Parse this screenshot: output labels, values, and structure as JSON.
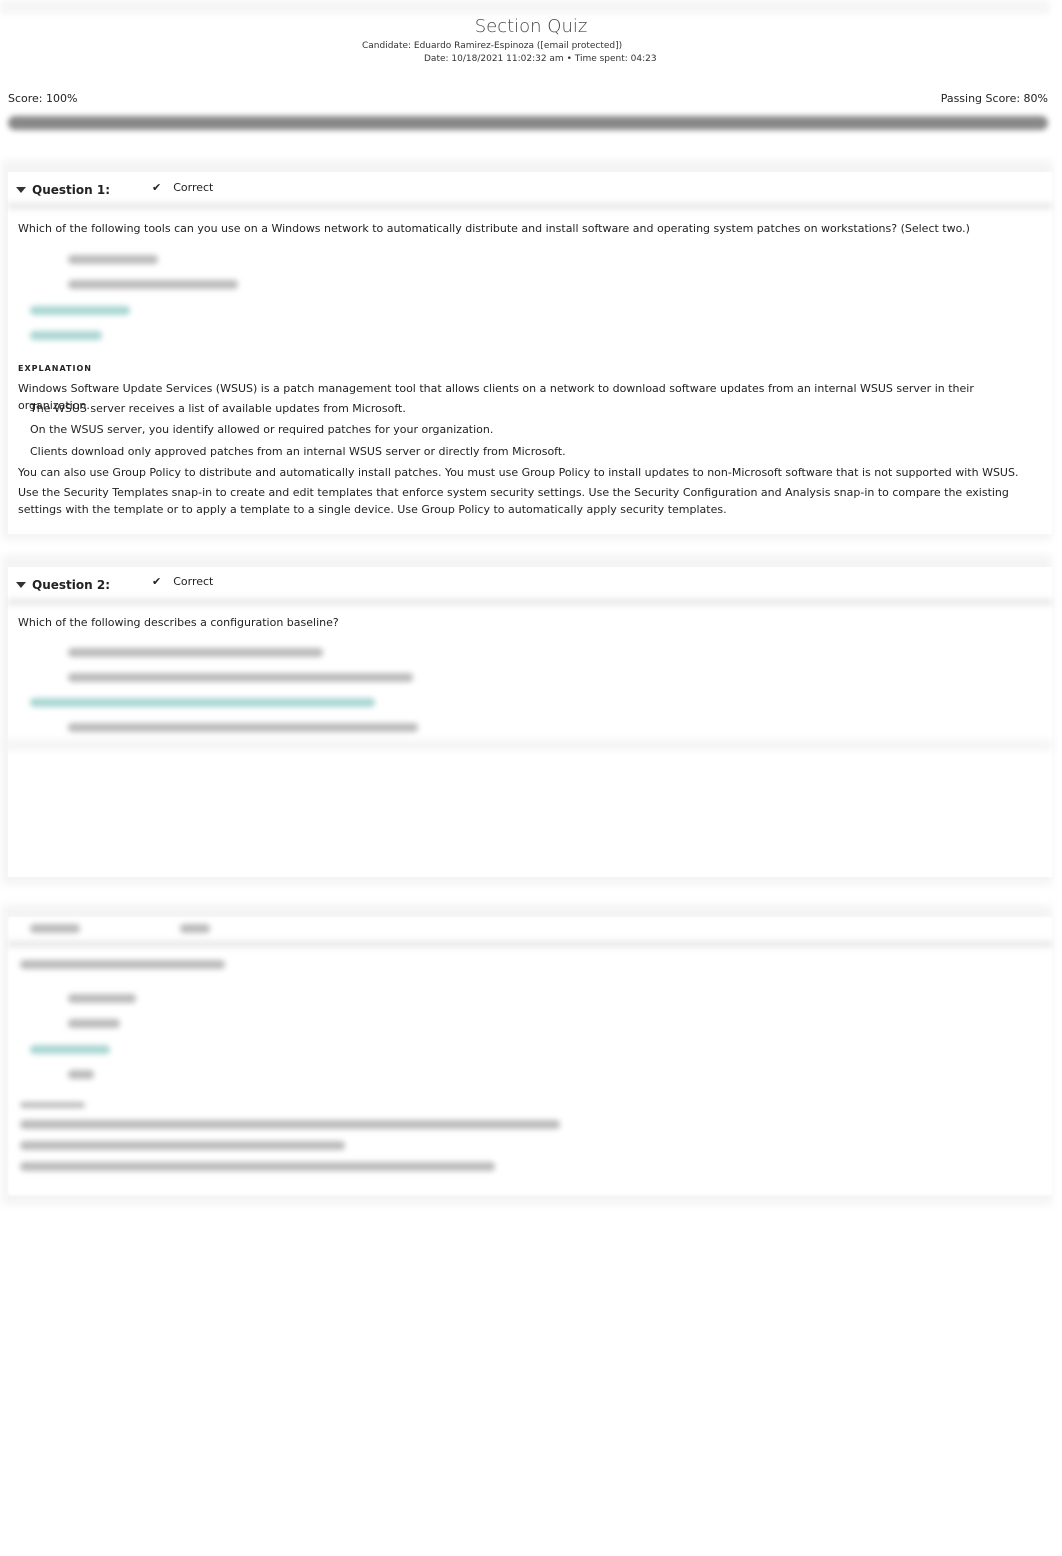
{
  "header": {
    "title": "Section Quiz",
    "candidate": "Candidate: Eduardo Ramirez-Espinoza ([email protected])",
    "date": "Date: 10/18/2021 11:02:32 am • Time spent: 04:23",
    "score": "Score: 100%",
    "passing": "Passing Score: 80%",
    "progress_percent": 100
  },
  "questions": [
    {
      "label": "Question 1:",
      "status": "Correct",
      "status_icon": "check-icon",
      "text": "Which of the following tools can you use on a Windows network to automatically distribute and install software and operating system patches on workstations? (Select two.)",
      "explanation_heading": "EXPLANATION",
      "explanation": [
        "Windows Software Update Services (WSUS) is a patch management tool that allows clients on a network to download software updates from an internal WSUS server in their organization.",
        "The WSUS server receives a list of available updates from Microsoft.",
        "On the WSUS server, you identify allowed or required patches for your organization.",
        "Clients download only approved patches from an internal WSUS server or directly from Microsoft.",
        "You can also use Group Policy to distribute and automatically install patches. You must use Group Policy to install updates to non-Microsoft software that is not supported with WSUS.",
        "Use the Security Templates snap-in to create and edit templates that enforce system security settings. Use the Security Configuration and Analysis snap-in to compare the existing settings with the template or to apply a template to a single device. Use Group Policy to automatically apply security templates."
      ]
    },
    {
      "label": "Question 2:",
      "status": "Correct",
      "status_icon": "check-icon",
      "text": "Which of the following describes a configuration baseline?"
    }
  ],
  "colors": {
    "correct_answer": "#a9d6d2",
    "progress": "#888888"
  }
}
